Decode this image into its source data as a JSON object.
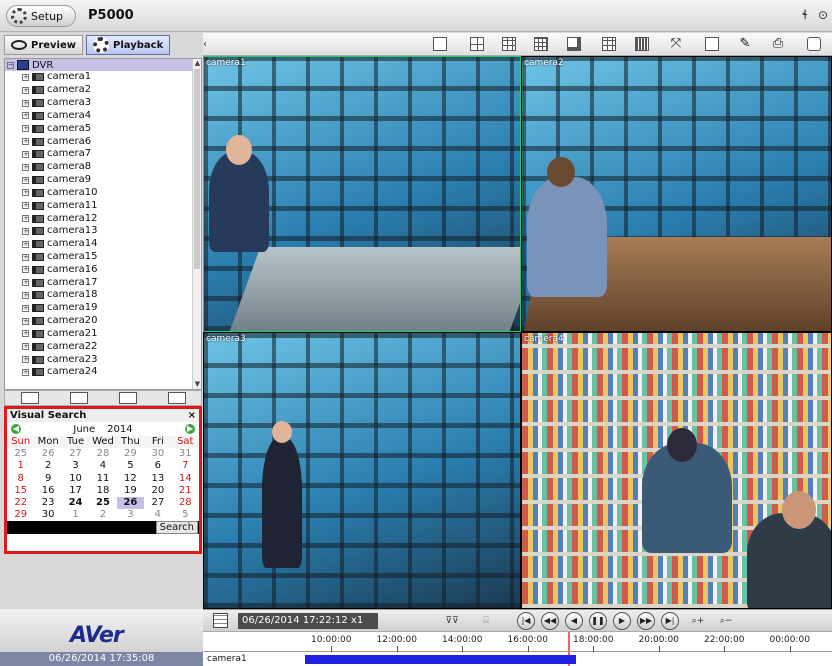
{
  "titlebar": {
    "setup_label": "Setup",
    "app_title": "P5000",
    "win_min": "ɬ",
    "win_close": "⊙"
  },
  "modes": {
    "preview_label": "Preview",
    "playback_label": "Playback"
  },
  "tree": {
    "root_label": "DVR",
    "cameras": [
      "camera1",
      "camera2",
      "camera3",
      "camera4",
      "camera5",
      "camera6",
      "camera7",
      "camera8",
      "camera9",
      "camera10",
      "camera11",
      "camera12",
      "camera13",
      "camera14",
      "camera15",
      "camera16",
      "camera17",
      "camera18",
      "camera19",
      "camera20",
      "camera21",
      "camera22",
      "camera23",
      "camera24"
    ]
  },
  "visual_search": {
    "title": "Visual Search",
    "close": "×",
    "month": "June",
    "year": "2014",
    "weekdays": [
      "Sun",
      "Mon",
      "Tue",
      "Wed",
      "Thu",
      "Fri",
      "Sat"
    ],
    "search_label": "Search",
    "days": [
      [
        "25",
        "26",
        "27",
        "28",
        "29",
        "30",
        "31"
      ],
      [
        "1",
        "2",
        "3",
        "4",
        "5",
        "6",
        "7"
      ],
      [
        "8",
        "9",
        "10",
        "11",
        "12",
        "13",
        "14"
      ],
      [
        "15",
        "16",
        "17",
        "18",
        "19",
        "20",
        "21"
      ],
      [
        "22",
        "23",
        "24",
        "25",
        "26",
        "27",
        "28"
      ],
      [
        "29",
        "30",
        "1",
        "2",
        "3",
        "4",
        "5"
      ]
    ],
    "selected_day": "26"
  },
  "grid": {
    "labels": [
      "camera1",
      "camera2",
      "camera3",
      "camera4"
    ]
  },
  "brand": {
    "logo": "AVer",
    "clock": "06/26/2014 17:35:08"
  },
  "playback": {
    "datetime": "06/26/2014 17:22:12 x1",
    "times": [
      "10:00:00",
      "12:00:00",
      "14:00:00",
      "16:00:00",
      "18:00:00",
      "20:00:00",
      "22:00:00",
      "00:00:00"
    ],
    "track_label": "camera1"
  }
}
